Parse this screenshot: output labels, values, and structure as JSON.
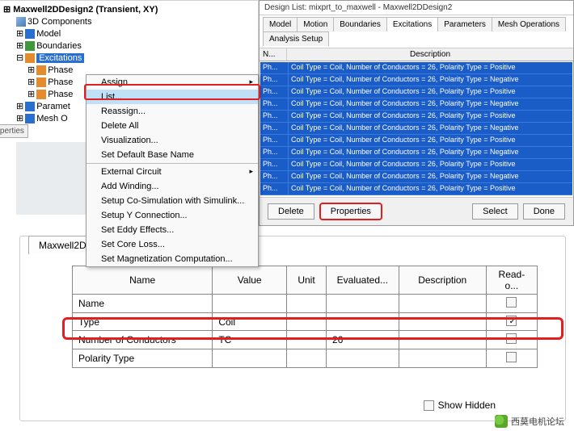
{
  "tree": {
    "root": "Maxwell2DDesign2 (Transient, XY)",
    "items": [
      "3D Components",
      "Model",
      "Boundaries",
      "Excitations"
    ],
    "phases": [
      "Phase",
      "Phase",
      "Phase",
      "Paramet",
      "Mesh O"
    ]
  },
  "props_tab": "roperties",
  "context_menu": {
    "items": [
      {
        "label": "Assign",
        "sub": true
      },
      {
        "label": "List...",
        "sel": true
      },
      {
        "label": "Reassign..."
      },
      {
        "label": "Delete All"
      },
      {
        "label": "Visualization..."
      },
      {
        "label": "Set Default Base Name"
      },
      {
        "sep": true
      },
      {
        "label": "External Circuit",
        "sub": true
      },
      {
        "label": "Add Winding..."
      },
      {
        "label": "Setup Co-Simulation with Simulink..."
      },
      {
        "label": "Setup Y Connection..."
      },
      {
        "label": "Set Eddy Effects..."
      },
      {
        "label": "Set Core Loss..."
      },
      {
        "label": "Set Magnetization Computation..."
      }
    ]
  },
  "design_list": {
    "title": "Design List: mixprt_to_maxwell - Maxwell2DDesign2",
    "tabs": [
      "Model",
      "Motion",
      "Boundaries",
      "Excitations",
      "Parameters",
      "Mesh Operations",
      "Analysis Setup"
    ],
    "active_tab": 3,
    "header_n": "N...",
    "header_d": "Description",
    "rows": [
      {
        "n": "Ph...",
        "d": "Coil Type = Coil, Number of Conductors = 26, Polarity Type = Positive"
      },
      {
        "n": "Ph...",
        "d": "Coil Type = Coil, Number of Conductors = 26, Polarity Type = Negative"
      },
      {
        "n": "Ph...",
        "d": "Coil Type = Coil, Number of Conductors = 26, Polarity Type = Positive"
      },
      {
        "n": "Ph...",
        "d": "Coil Type = Coil, Number of Conductors = 26, Polarity Type = Negative"
      },
      {
        "n": "Ph...",
        "d": "Coil Type = Coil, Number of Conductors = 26, Polarity Type = Positive"
      },
      {
        "n": "Ph...",
        "d": "Coil Type = Coil, Number of Conductors = 26, Polarity Type = Negative"
      },
      {
        "n": "Ph...",
        "d": "Coil Type = Coil, Number of Conductors = 26, Polarity Type = Positive"
      },
      {
        "n": "Ph...",
        "d": "Coil Type = Coil, Number of Conductors = 26, Polarity Type = Negative"
      },
      {
        "n": "Ph...",
        "d": "Coil Type = Coil, Number of Conductors = 26, Polarity Type = Positive"
      },
      {
        "n": "Ph...",
        "d": "Coil Type = Coil, Number of Conductors = 26, Polarity Type = Negative"
      },
      {
        "n": "Ph...",
        "d": "Coil Type = Coil, Number of Conductors = 26, Polarity Type = Positive"
      }
    ],
    "buttons": {
      "delete": "Delete",
      "properties": "Properties",
      "select": "Select",
      "done": "Done"
    }
  },
  "bottom_panel": {
    "tab": "Maxwell2D",
    "columns": [
      "Name",
      "Value",
      "Unit",
      "Evaluated...",
      "Description",
      "Read-o..."
    ],
    "rows": [
      {
        "name": "Name",
        "value": "",
        "unit": "",
        "eval": "",
        "desc": "",
        "ro": false
      },
      {
        "name": "Type",
        "value": "Coil",
        "unit": "",
        "eval": "",
        "desc": "",
        "ro": true
      },
      {
        "name": "Number of Conductors",
        "value": "TC",
        "unit": "",
        "eval": "26",
        "desc": "",
        "ro": false
      },
      {
        "name": "Polarity Type",
        "value": "",
        "unit": "",
        "eval": "",
        "desc": "",
        "ro": false
      }
    ],
    "show_hidden": "Show Hidden"
  },
  "footer": "西莫电机论坛"
}
